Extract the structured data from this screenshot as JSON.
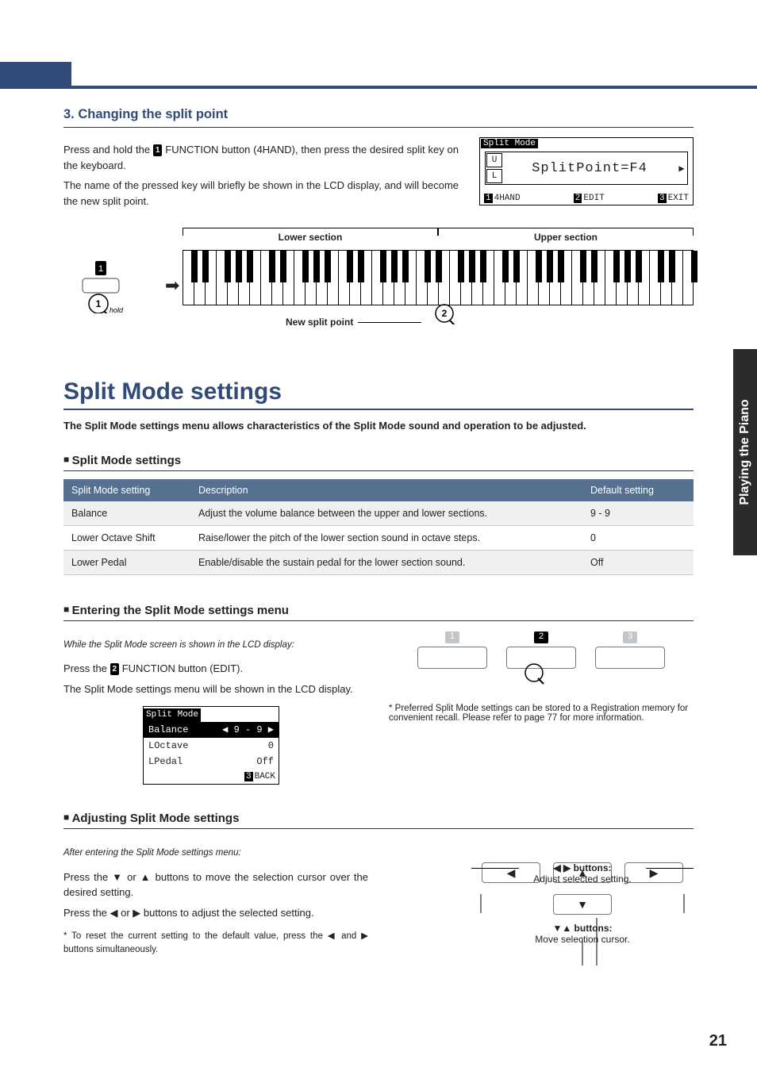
{
  "sidebar_tab": "Playing the Piano",
  "page_number": "21",
  "section3": {
    "title": "3. Changing the split point",
    "p1a": "Press and hold the ",
    "p1_badge": "1",
    "p1b": " FUNCTION button (4HAND), then press the desired split key on the keyboard.",
    "p2": "The name of the pressed key will briefly be shown in the LCD display, and will become the new split point.",
    "lcd_title": "Split Mode",
    "lcd_main": "SplitPoint=F4",
    "lcd_u": "U",
    "lcd_l": "L",
    "lcd_fn1_num": "1",
    "lcd_fn1": "4HAND",
    "lcd_fn2_num": "2",
    "lcd_fn2": "EDIT",
    "lcd_fn3_num": "3",
    "lcd_fn3": "EXIT",
    "kb_lower": "Lower section",
    "kb_upper": "Upper section",
    "kb_newsplit": "New split point",
    "hold": "hold"
  },
  "main_title": "Split Mode settings",
  "intro": "The Split Mode settings menu allows characteristics of the Split Mode sound and operation to be adjusted.",
  "table_head": "Split Mode settings",
  "table": {
    "h1": "Split Mode setting",
    "h2": "Description",
    "h3": "Default setting",
    "rows": [
      {
        "c1": "Balance",
        "c2": "Adjust the volume balance between the upper and lower sections.",
        "c3": "9 - 9"
      },
      {
        "c1": "Lower Octave Shift",
        "c2": "Raise/lower the pitch of the lower section sound in octave steps.",
        "c3": "0"
      },
      {
        "c1": "Lower Pedal",
        "c2": "Enable/disable the sustain pedal for the lower section sound.",
        "c3": "Off"
      }
    ]
  },
  "enter": {
    "title": "Entering the Split Mode settings menu",
    "i1": "While the Split Mode screen is shown in the LCD display:",
    "p1a": "Press the ",
    "p1_badge": "2",
    "p1b": " FUNCTION button (EDIT).",
    "p2": "The Split Mode settings menu will be shown in the LCD display.",
    "lcd_title": "Split Mode",
    "r1a": "Balance",
    "r1b": "◀  9 - 9 ▶",
    "r2a": "LOctave",
    "r2b": "0",
    "r3a": "LPedal",
    "r3b": "Off",
    "foot_num": "3",
    "foot": "BACK",
    "btn1": "1",
    "btn2": "2",
    "btn3": "3",
    "note": "* Preferred Split Mode settings can be stored to a Registration memory for convenient recall.  Please refer to page 77 for more information."
  },
  "adjust": {
    "title": "Adjusting Split Mode settings",
    "i1": "After entering the Split Mode settings menu:",
    "p1": "Press the ▼ or ▲ buttons to move the selection cursor over the desired setting.",
    "p2": "Press the ◀ or ▶ buttons to adjust the selected setting.",
    "foot": "* To reset the current setting to the default value, press the ◀ and ▶ buttons simultaneously.",
    "lr_label_b": "◀ ▶ buttons:",
    "lr_label": "Adjust selected setting.",
    "ud_label_b": "▼▲ buttons:",
    "ud_label": "Move selection cursor."
  }
}
